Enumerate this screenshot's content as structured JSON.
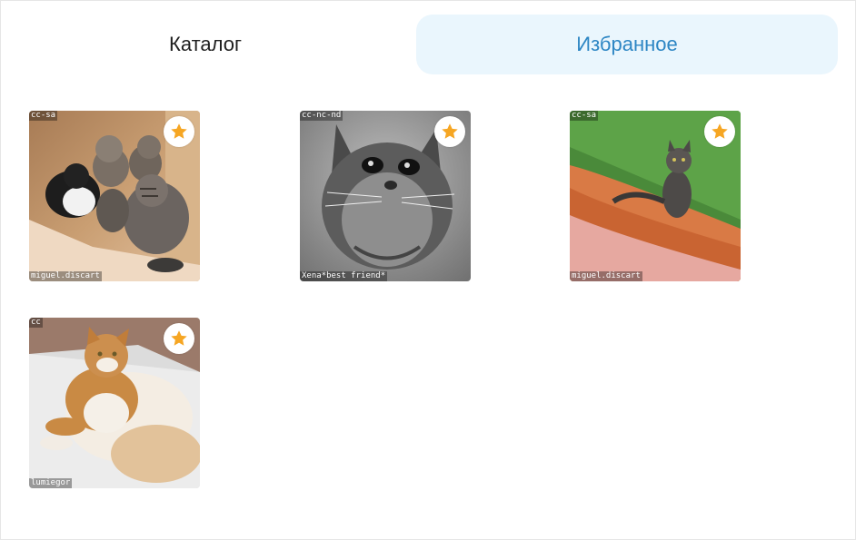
{
  "tabs": [
    {
      "label": "Каталог",
      "active": false
    },
    {
      "label": "Избранное",
      "active": true
    }
  ],
  "colors": {
    "active_tab_bg": "#eaf6fd",
    "active_tab_text": "#2d86c4",
    "star": "#f6a623"
  },
  "cards": [
    {
      "license": "cc-sa",
      "author": "miguel.discart",
      "favorite": true,
      "icon": "star-icon"
    },
    {
      "license": "cc-nc-nd",
      "author": "Xena*best friend*",
      "favorite": true,
      "icon": "star-icon"
    },
    {
      "license": "cc-sa",
      "author": "miguel.discart",
      "favorite": true,
      "icon": "star-icon"
    },
    {
      "license": "cc",
      "author": "lumiegor",
      "favorite": true,
      "icon": "star-icon"
    }
  ]
}
